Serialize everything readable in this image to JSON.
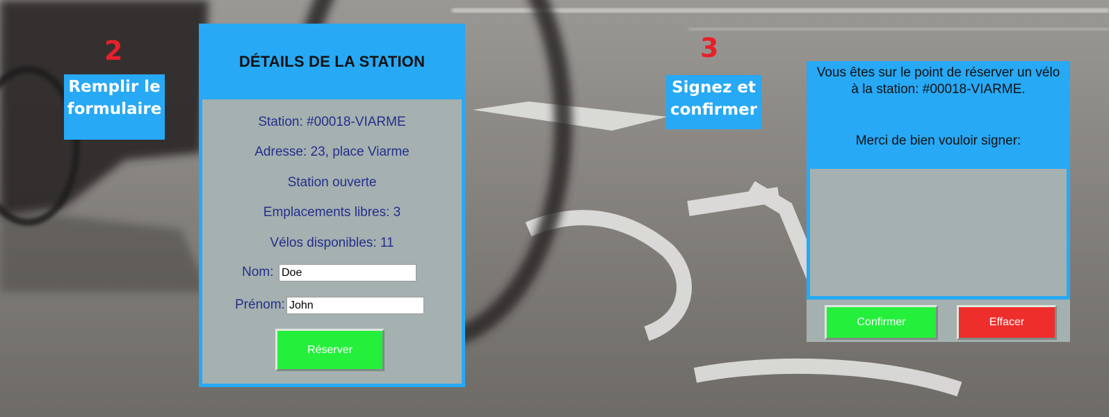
{
  "steps": [
    {
      "number": "2",
      "label_line1": "Remplir le",
      "label_line2": "formulaire"
    },
    {
      "number": "3",
      "label_line1": "Signez et",
      "label_line2": "confirmer"
    }
  ],
  "details": {
    "title": "DÉTAILS DE LA STATION",
    "station": "Station: #00018-VIARME",
    "address": "Adresse: 23, place Viarme",
    "status": "Station ouverte",
    "free_slots": "Emplacements libres: 3",
    "bikes_available": "Vélos disponibles: 11",
    "form": {
      "last_name_label": "Nom:",
      "last_name_value": "Doe",
      "first_name_label": "Prénom:",
      "first_name_value": "John",
      "reserve_button": "Réserver"
    }
  },
  "signature": {
    "message_line1": "Vous êtes sur le point de réserver un vélo",
    "message_line2": "à la station: #00018-VIARME.",
    "sign_prompt": "Merci de bien vouloir signer:",
    "confirm_button": "Confirmer",
    "clear_button": "Effacer"
  },
  "colors": {
    "panel_blue": "#27a9f5",
    "panel_grey": "#a5b0b0",
    "info_text": "#232f8c",
    "step_number": "#e8202a",
    "confirm_green": "#24f03c",
    "clear_red": "#ee2e2b"
  }
}
